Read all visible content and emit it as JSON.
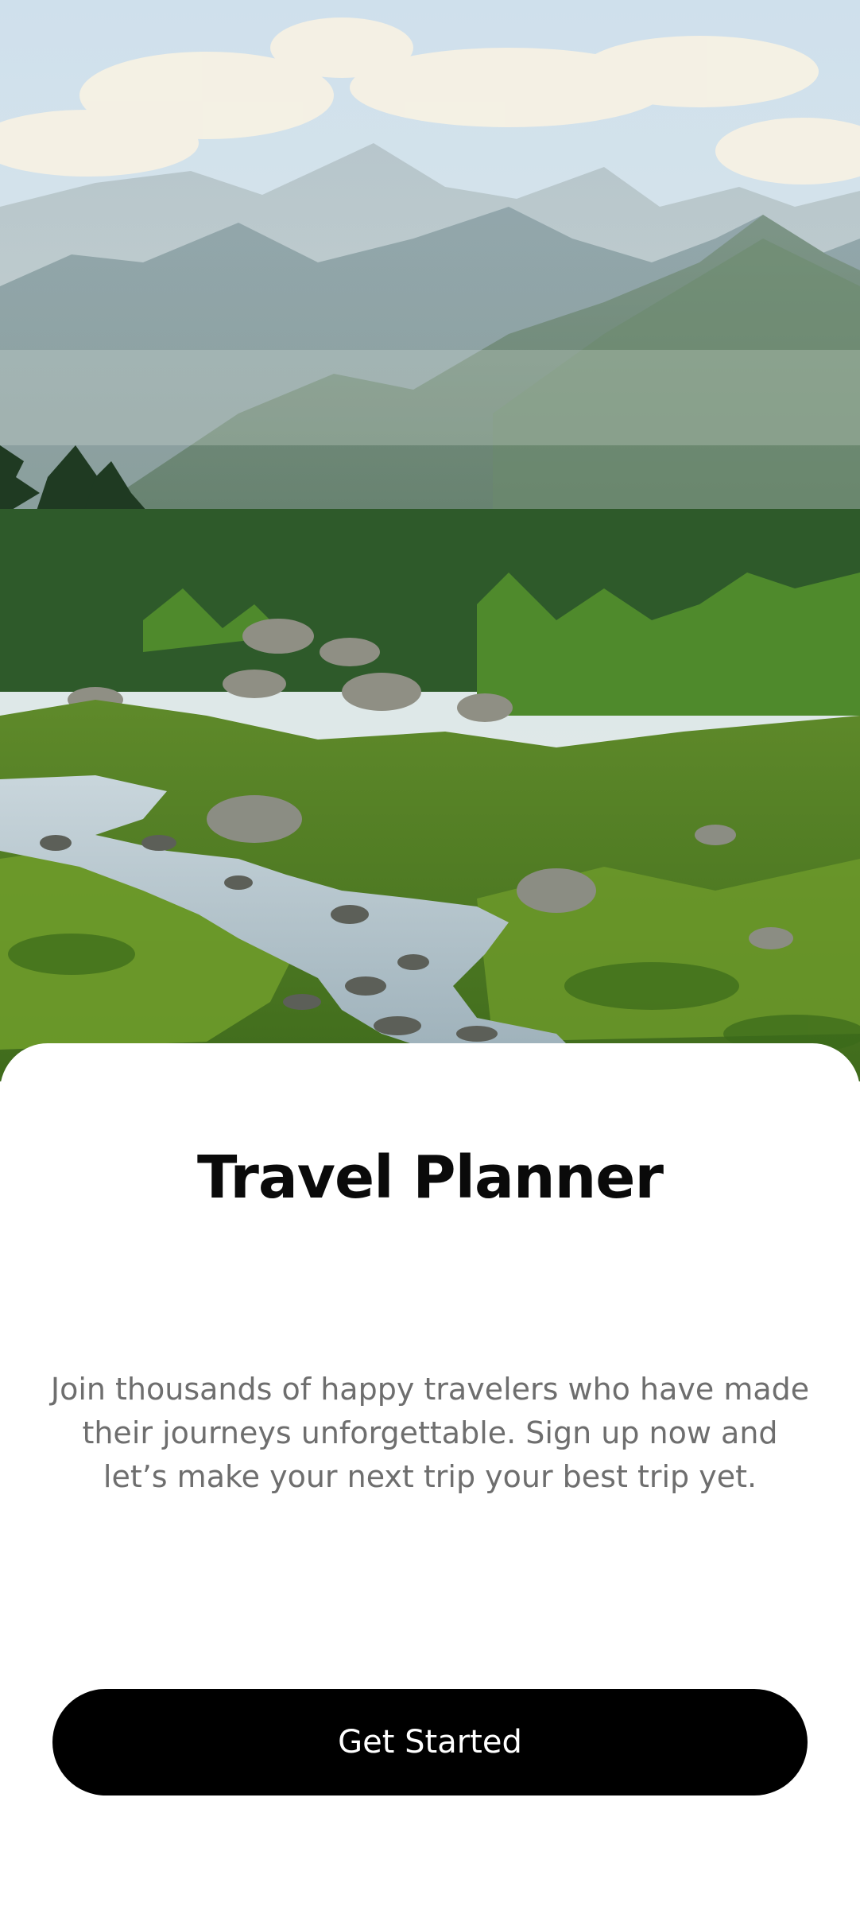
{
  "hero": {
    "image_name": "mountain-valley-stream-photo"
  },
  "welcome": {
    "title": "Travel Planner",
    "description": "Join thousands of happy travelers who have made their journeys unforgettable. Sign up now and let’s make your next trip your best trip yet.",
    "cta_label": "Get Started"
  },
  "colors": {
    "background": "#ffffff",
    "title": "#0a0a0a",
    "description": "#6e6e6e",
    "button_background": "#000000",
    "button_text": "#ffffff"
  }
}
